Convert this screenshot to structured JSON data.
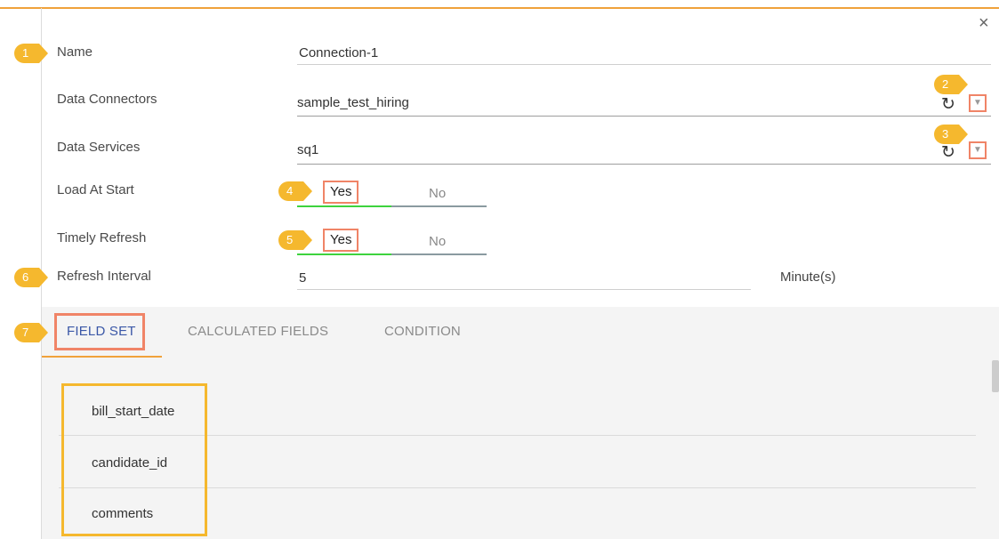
{
  "form": {
    "name": {
      "label": "Name",
      "value": "Connection-1"
    },
    "data_connectors": {
      "label": "Data Connectors",
      "value": "sample_test_hiring"
    },
    "data_services": {
      "label": "Data Services",
      "value": "sq1"
    },
    "load_at_start": {
      "label": "Load At Start",
      "yes": "Yes",
      "no": "No"
    },
    "timely_refresh": {
      "label": "Timely Refresh",
      "yes": "Yes",
      "no": "No"
    },
    "refresh_interval": {
      "label": "Refresh Interval",
      "value": "5",
      "unit": "Minute(s)"
    }
  },
  "close_glyph": "×",
  "refresh_glyph": "↻",
  "dropdown_glyph": "▼",
  "badges": [
    "1",
    "2",
    "3",
    "4",
    "5",
    "6",
    "7"
  ],
  "tabs": [
    {
      "label": "FIELD SET",
      "active": true
    },
    {
      "label": "CALCULATED FIELDS",
      "active": false
    },
    {
      "label": "CONDITION",
      "active": false
    }
  ],
  "fields": [
    "bill_start_date",
    "candidate_id",
    "comments"
  ],
  "colors": {
    "accent_orange": "#f0a23b",
    "badge_yellow": "#f5b82e",
    "highlight_salmon": "#f08467",
    "toggle_green": "#3ed33e",
    "tab_active_blue": "#3a57a7"
  },
  "icons": {
    "close": "close-icon",
    "refresh": "refresh-icon",
    "dropdown": "chevron-down-icon"
  }
}
